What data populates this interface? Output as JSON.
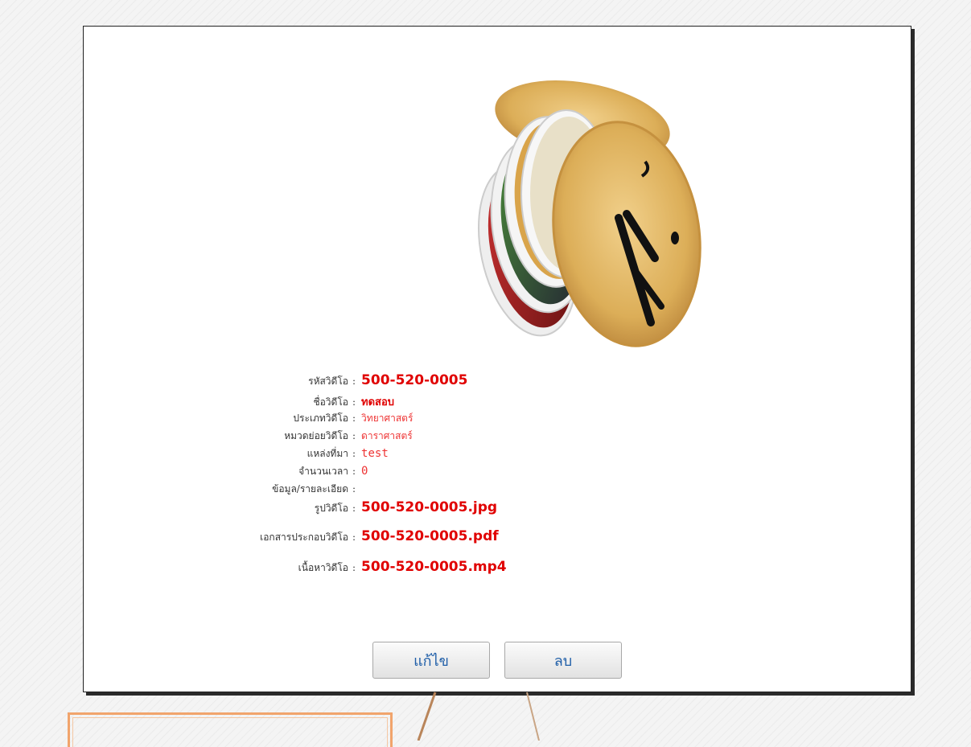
{
  "video": {
    "labels": {
      "code": "รหัสวิดีโอ",
      "name": "ชื่อวิดีโอ",
      "type": "ประเภทวิดีโอ",
      "subcategory": "หมวดย่อยวิดีโอ",
      "source": "แหล่งที่มา",
      "duration": "จำนวนเวลา",
      "details": "ข้อมูล/รายละเอียด",
      "image": "รูปวิดีโอ",
      "document": "เอกสารประกอบวิดีโอ",
      "content": "เนื้อหาวิดีโอ"
    },
    "values": {
      "code": "500-520-0005",
      "name": "ทดสอบ",
      "type": "วิทยาศาสตร์",
      "subcategory": "ดาราศาสตร์",
      "source": "test",
      "duration": "0",
      "details": "",
      "image": "500-520-0005.jpg",
      "document": "500-520-0005.pdf",
      "content": "500-520-0005.mp4"
    },
    "colon": ":"
  },
  "actions": {
    "edit_label": "แก้ไข",
    "delete_label": "ลบ"
  },
  "colors": {
    "value_red": "#e00000",
    "button_text": "#1f5ea8",
    "callout_orange": "#f1a46c",
    "pointer_brown": "#b9855a"
  }
}
